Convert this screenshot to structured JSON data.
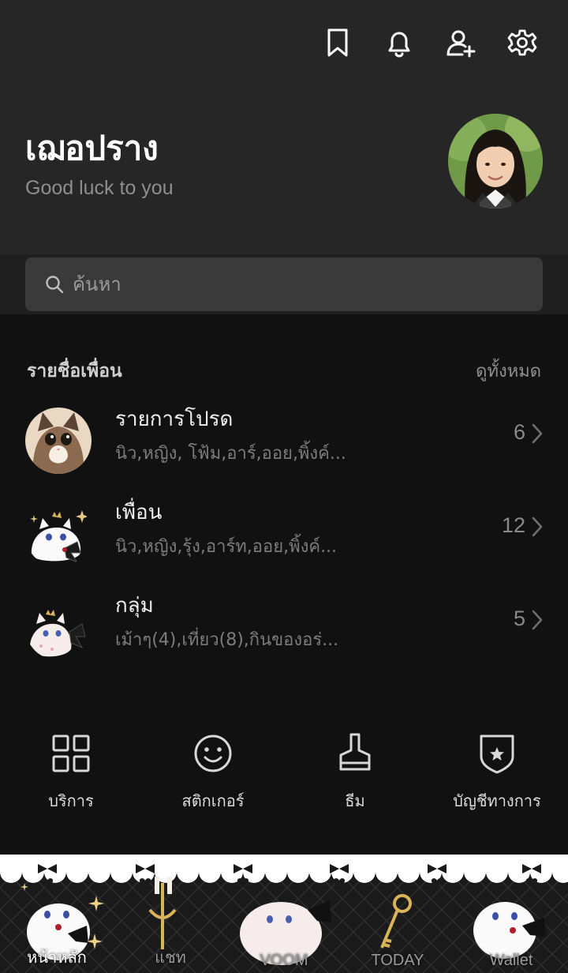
{
  "header": {
    "icons": [
      "bookmark-icon",
      "bell-icon",
      "add-friend-icon",
      "gear-icon"
    ]
  },
  "profile": {
    "name": "เฌอปราง",
    "status": "Good luck to you"
  },
  "search": {
    "placeholder": "ค้นหา"
  },
  "friends_section": {
    "title": "รายชื่อเพื่อน",
    "see_all": "ดูทั้งหมด",
    "rows": [
      {
        "title": "รายการโปรด",
        "subtitle": "นิว,หญิง, โฟ้ม,อาร์,ออย,พิ้งค์...",
        "count": "6"
      },
      {
        "title": "เพื่อน",
        "subtitle": "นิว,หญิง,รุ้ง,อาร์ท,ออย,พิ้งค์...",
        "count": "12"
      },
      {
        "title": "กลุ่ม",
        "subtitle": "เม้าๆ(4),เที่ยว(8),กินของอร่...",
        "count": "5"
      }
    ]
  },
  "shortcuts": [
    {
      "label": "บริการ",
      "icon": "grid-icon"
    },
    {
      "label": "สติกเกอร์",
      "icon": "smiley-icon"
    },
    {
      "label": "ธีม",
      "icon": "brush-icon"
    },
    {
      "label": "บัญชีทางการ",
      "icon": "shield-star-icon"
    }
  ],
  "tabbar": {
    "tabs": [
      {
        "label": "หน้าหลัก",
        "active": true
      },
      {
        "label": "แชท",
        "active": false
      },
      {
        "label": "VOOM",
        "active": false
      },
      {
        "label": "TODAY",
        "active": false
      },
      {
        "label": "Wallet",
        "active": false
      }
    ]
  },
  "colors": {
    "background": "#111111",
    "header": "#262626",
    "search_box": "#3a3a3a",
    "text_primary": "#efefef",
    "text_secondary": "#7c7c7c"
  }
}
